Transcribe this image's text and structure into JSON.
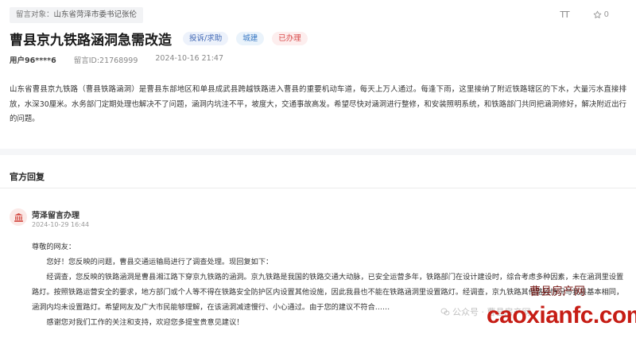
{
  "target": {
    "label": "留言对象：",
    "value": "山东省菏泽市委书记张伦"
  },
  "toolbar": {
    "font_icon_text": "TT",
    "like_count": "0"
  },
  "message": {
    "title": "曹县京九铁路涵洞急需改造",
    "tags": [
      "投诉/求助",
      "城建",
      "已办理"
    ],
    "user": "用户96****6",
    "id_text": "留言ID:21768999",
    "time": "2024-10-16 21:47",
    "content": "山东省曹县京九铁路（曹县铁路涵洞）是曹县东部地区和单县成武县跨越铁路进入曹县的重要机动车道，每天上万人通过。每逢下雨，这里接纳了附近铁路辖区的下水，大量污水直接排放，水深30厘米。水务部门定期处理也解决不了问题，涵洞内坑洼不平，坡度大，交通事故高发。希望尽快对涵洞进行整修，和安装照明系统，和铁路部门共同把涵洞修好，解决附近出行的问题。"
  },
  "reply": {
    "heading": "官方回复",
    "org_name": "菏泽留言办理",
    "org_time": "2024-10-29 16:44",
    "greeting": "尊敬的网友：",
    "p1": "您好！您反映的问题，曹县交通运输局进行了调查处理。现回复如下：",
    "p2": "经调查，您反映的铁路涵洞是曹县湘江路下穿京九铁路的涵洞。京九铁路是我国的铁路交通大动脉，已安全运营多年，铁路部门在设计建设时，综合考虑多种因素，未在涵洞里设置路灯。按照铁路运营安全的要求，地方部门或个人等不得在铁路安全防护区内设置其他设施，因此我县也不能在铁路涵洞里设置路灯。经调查，京九铁路其他路段情况与我县基本相同，涵洞内均未设置路灯。希望网友及广大市民能够理解，在该涵洞减速慢行、小心通过。由于您的建议不符合……",
    "p3": "感谢您对我们工作的关注和支持，欢迎您多提宝贵意见建议！"
  },
  "watermarks": {
    "wechat": "公众号 · 曹县房产网",
    "site_cn": "曹县房产网",
    "site_en": "caoxianfc.com"
  },
  "colors": {
    "status_red": "#d84a4a",
    "tag_blue": "#3f66b4",
    "brand_red": "#c61d15"
  }
}
